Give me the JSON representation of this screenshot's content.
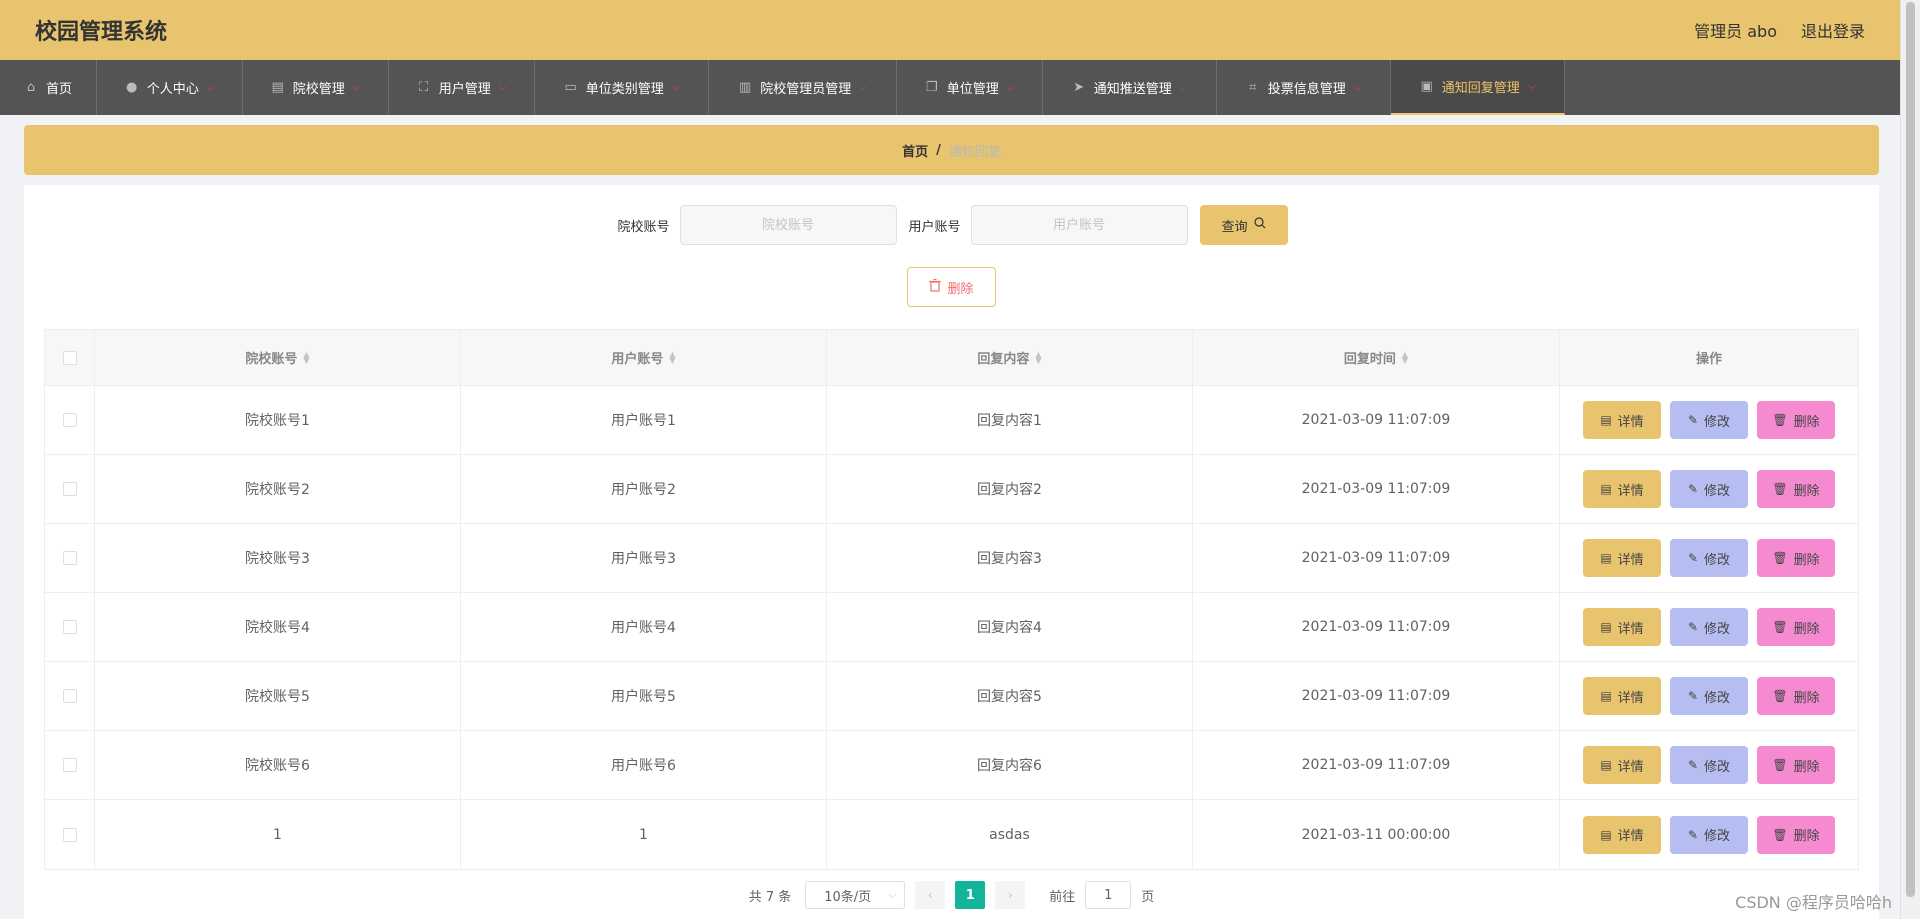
{
  "header": {
    "title": "校园管理系统",
    "user": "管理员 abo",
    "logout": "退出登录"
  },
  "nav": [
    {
      "label": "首页",
      "icon": "home-icon",
      "glyph": "⌂",
      "has_menu": false,
      "width": 97,
      "active": false
    },
    {
      "label": "个人中心",
      "icon": "user-icon",
      "glyph": "●",
      "has_menu": true,
      "width": 146,
      "active": false
    },
    {
      "label": "院校管理",
      "icon": "building-icon",
      "glyph": "▤",
      "has_menu": true,
      "width": 146,
      "active": false
    },
    {
      "label": "用户管理",
      "icon": "fullscreen-icon",
      "glyph": "⛶",
      "has_menu": true,
      "width": 146,
      "active": false
    },
    {
      "label": "单位类别管理",
      "icon": "message-icon",
      "glyph": "▭",
      "has_menu": true,
      "width": 174,
      "active": false
    },
    {
      "label": "院校管理员管理",
      "icon": "clipboard-icon",
      "glyph": "▥",
      "has_menu": true,
      "width": 188,
      "active": false
    },
    {
      "label": "单位管理",
      "icon": "copy-icon",
      "glyph": "❐",
      "has_menu": true,
      "width": 146,
      "active": false
    },
    {
      "label": "通知推送管理",
      "icon": "send-icon",
      "glyph": "➤",
      "has_menu": true,
      "width": 174,
      "active": false
    },
    {
      "label": "投票信息管理",
      "icon": "crop-icon",
      "glyph": "⌗",
      "has_menu": true,
      "width": 174,
      "active": false
    },
    {
      "label": "通知回复管理",
      "icon": "document-icon",
      "glyph": "▣",
      "has_menu": true,
      "width": 174,
      "active": true
    }
  ],
  "breadcrumb": {
    "home": "首页",
    "sep": "/",
    "current": "通知回复"
  },
  "search": {
    "school_label": "院校账号",
    "school_placeholder": "院校账号",
    "user_label": "用户账号",
    "user_placeholder": "用户账号",
    "query_label": "查询"
  },
  "delete_label": "删除",
  "table": {
    "headers": [
      "院校账号",
      "用户账号",
      "回复内容",
      "回复时间",
      "操作"
    ],
    "rows": [
      [
        "院校账号1",
        "用户账号1",
        "回复内容1",
        "2021-03-09 11:07:09"
      ],
      [
        "院校账号2",
        "用户账号2",
        "回复内容2",
        "2021-03-09 11:07:09"
      ],
      [
        "院校账号3",
        "用户账号3",
        "回复内容3",
        "2021-03-09 11:07:09"
      ],
      [
        "院校账号4",
        "用户账号4",
        "回复内容4",
        "2021-03-09 11:07:09"
      ],
      [
        "院校账号5",
        "用户账号5",
        "回复内容5",
        "2021-03-09 11:07:09"
      ],
      [
        "院校账号6",
        "用户账号6",
        "回复内容6",
        "2021-03-09 11:07:09"
      ],
      [
        "1",
        "1",
        "asdas",
        "2021-03-11 00:00:00"
      ]
    ],
    "actions": {
      "detail": "详情",
      "edit": "修改",
      "delete": "删除"
    }
  },
  "pagination": {
    "total": "共 7 条",
    "page_size": "10条/页",
    "current_page": "1",
    "goto_label": "前往",
    "goto_value": "1",
    "page_suffix": "页"
  },
  "watermark": "CSDN @程序员哈哈h",
  "colors": {
    "header_bg": "#e8c46e",
    "nav_bg": "#545454",
    "active_text": "#f0c46a",
    "detail_btn": "#e8c46e",
    "edit_btn": "#b6bdf0",
    "delete_btn": "#f58ad0",
    "page_active": "#13b59a"
  }
}
